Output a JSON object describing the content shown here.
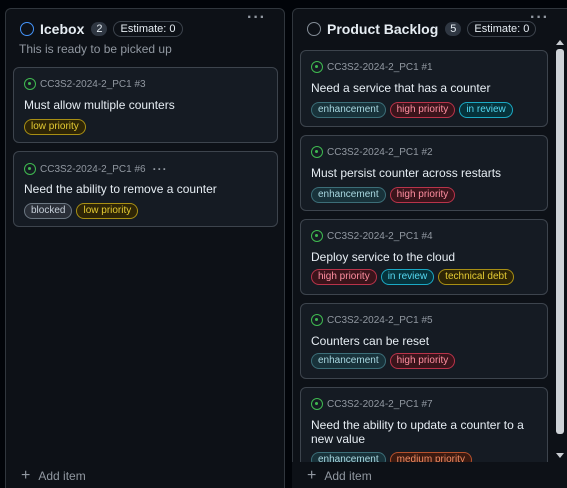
{
  "icebox": {
    "title": "Icebox",
    "count": "2",
    "estimate": "Estimate: 0",
    "menu": "···",
    "description": "This is ready to be picked up",
    "add_item": "Add item",
    "cards": [
      {
        "ref": "CC3S2-2024-2_PC1 #3",
        "title": "Must allow multiple counters",
        "labels": [
          {
            "text": "low priority",
            "kind": "low"
          }
        ]
      },
      {
        "ref": "CC3S2-2024-2_PC1 #6",
        "menu": "···",
        "title": "Need the ability to remove a counter",
        "labels": [
          {
            "text": "blocked",
            "kind": "blocked"
          },
          {
            "text": "low priority",
            "kind": "low"
          }
        ]
      }
    ]
  },
  "backlog": {
    "title": "Product Backlog",
    "count": "5",
    "estimate": "Estimate: 0",
    "menu": "···",
    "add_item": "Add item",
    "cards": [
      {
        "ref": "CC3S2-2024-2_PC1 #1",
        "title": "Need a service that has a counter",
        "labels": [
          {
            "text": "enhancement",
            "kind": "enhancement"
          },
          {
            "text": "high priority",
            "kind": "high"
          },
          {
            "text": "in review",
            "kind": "review"
          }
        ]
      },
      {
        "ref": "CC3S2-2024-2_PC1 #2",
        "title": "Must persist counter across restarts",
        "labels": [
          {
            "text": "enhancement",
            "kind": "enhancement"
          },
          {
            "text": "high priority",
            "kind": "high"
          }
        ]
      },
      {
        "ref": "CC3S2-2024-2_PC1 #4",
        "title": "Deploy service to the cloud",
        "labels": [
          {
            "text": "high priority",
            "kind": "high"
          },
          {
            "text": "in review",
            "kind": "review"
          },
          {
            "text": "technical debt",
            "kind": "tech"
          }
        ]
      },
      {
        "ref": "CC3S2-2024-2_PC1 #5",
        "title": "Counters can be reset",
        "labels": [
          {
            "text": "enhancement",
            "kind": "enhancement"
          },
          {
            "text": "high priority",
            "kind": "high"
          }
        ]
      },
      {
        "ref": "CC3S2-2024-2_PC1 #7",
        "title": "Need the ability to update a counter to a new value",
        "labels": [
          {
            "text": "enhancement",
            "kind": "enhancement"
          },
          {
            "text": "medium priority",
            "kind": "medium"
          }
        ]
      }
    ]
  },
  "colors": {
    "background": "#010409",
    "column": "#0d1117",
    "card": "#151b23",
    "open_issue": "#3fb950",
    "icebox_status": "#4493f8"
  }
}
